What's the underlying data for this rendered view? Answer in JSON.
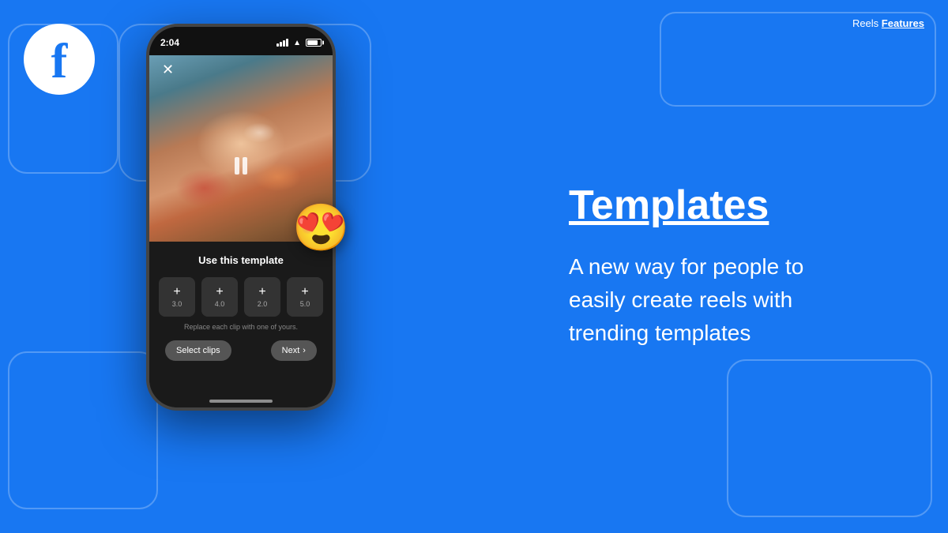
{
  "header": {
    "reels_label": "Reels ",
    "features_label": "Features"
  },
  "fb_logo": "f",
  "phone": {
    "time": "2:04",
    "close_symbol": "✕",
    "template_label": "Use this template",
    "clips": [
      {
        "plus": "+",
        "time": "3.0"
      },
      {
        "plus": "+",
        "time": "4.0"
      },
      {
        "plus": "+",
        "time": "2.0"
      },
      {
        "plus": "+",
        "time": "5.0"
      }
    ],
    "replace_text": "Replace each clip with one of yours.",
    "select_label": "Select clips",
    "next_label": "Next"
  },
  "main": {
    "title": "Templates",
    "description": "A new way for people to easily create reels with trending templates"
  },
  "emoji": "😍"
}
